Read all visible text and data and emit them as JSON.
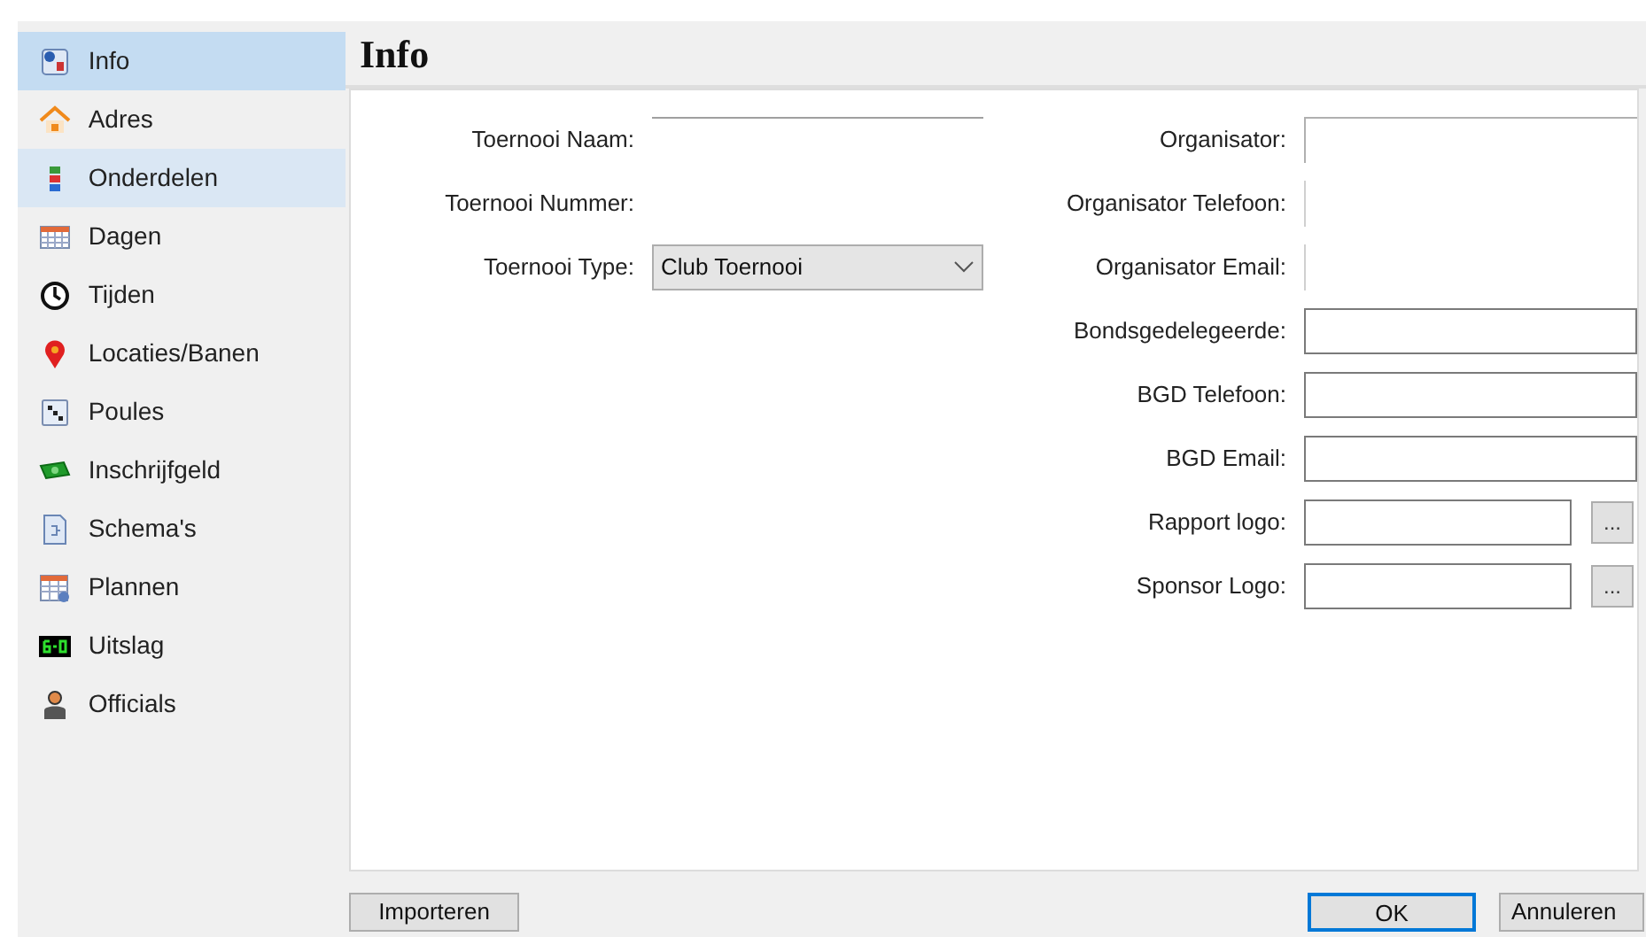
{
  "sidebar": {
    "items": [
      {
        "label": "Info",
        "selected": true,
        "highlighted": false
      },
      {
        "label": "Adres",
        "selected": false,
        "highlighted": false
      },
      {
        "label": "Onderdelen",
        "selected": false,
        "highlighted": true
      },
      {
        "label": "Dagen",
        "selected": false,
        "highlighted": false
      },
      {
        "label": "Tijden",
        "selected": false,
        "highlighted": false
      },
      {
        "label": "Locaties/Banen",
        "selected": false,
        "highlighted": false
      },
      {
        "label": "Poules",
        "selected": false,
        "highlighted": false
      },
      {
        "label": "Inschrijfgeld",
        "selected": false,
        "highlighted": false
      },
      {
        "label": "Schema's",
        "selected": false,
        "highlighted": false
      },
      {
        "label": "Plannen",
        "selected": false,
        "highlighted": false
      },
      {
        "label": "Uitslag",
        "selected": false,
        "highlighted": false
      },
      {
        "label": "Officials",
        "selected": false,
        "highlighted": false
      }
    ]
  },
  "header": {
    "title": "Info"
  },
  "left_fields": [
    {
      "label": "Toernooi Naam:",
      "kind": "topline"
    },
    {
      "label": "Toernooi Nummer:",
      "kind": "none"
    },
    {
      "label": "Toernooi Type:",
      "kind": "select",
      "value": "Club Toernooi"
    }
  ],
  "right_fields": [
    {
      "label": "Organisator:",
      "kind": "corner"
    },
    {
      "label": "Organisator Telefoon:",
      "kind": "edge"
    },
    {
      "label": "Organisator Email:",
      "kind": "edge"
    },
    {
      "label": "Bondsgedelegeerde:",
      "kind": "text"
    },
    {
      "label": "BGD Telefoon:",
      "kind": "text"
    },
    {
      "label": "BGD Email:",
      "kind": "text"
    },
    {
      "label": "Rapport logo:",
      "kind": "file",
      "browse": "..."
    },
    {
      "label": "Sponsor Logo:",
      "kind": "file",
      "browse": "..."
    }
  ],
  "buttons": [
    {
      "label": "Importeren",
      "default": false
    },
    {
      "label": "OK",
      "default": true
    },
    {
      "label": "Annuleren",
      "default": false
    }
  ]
}
